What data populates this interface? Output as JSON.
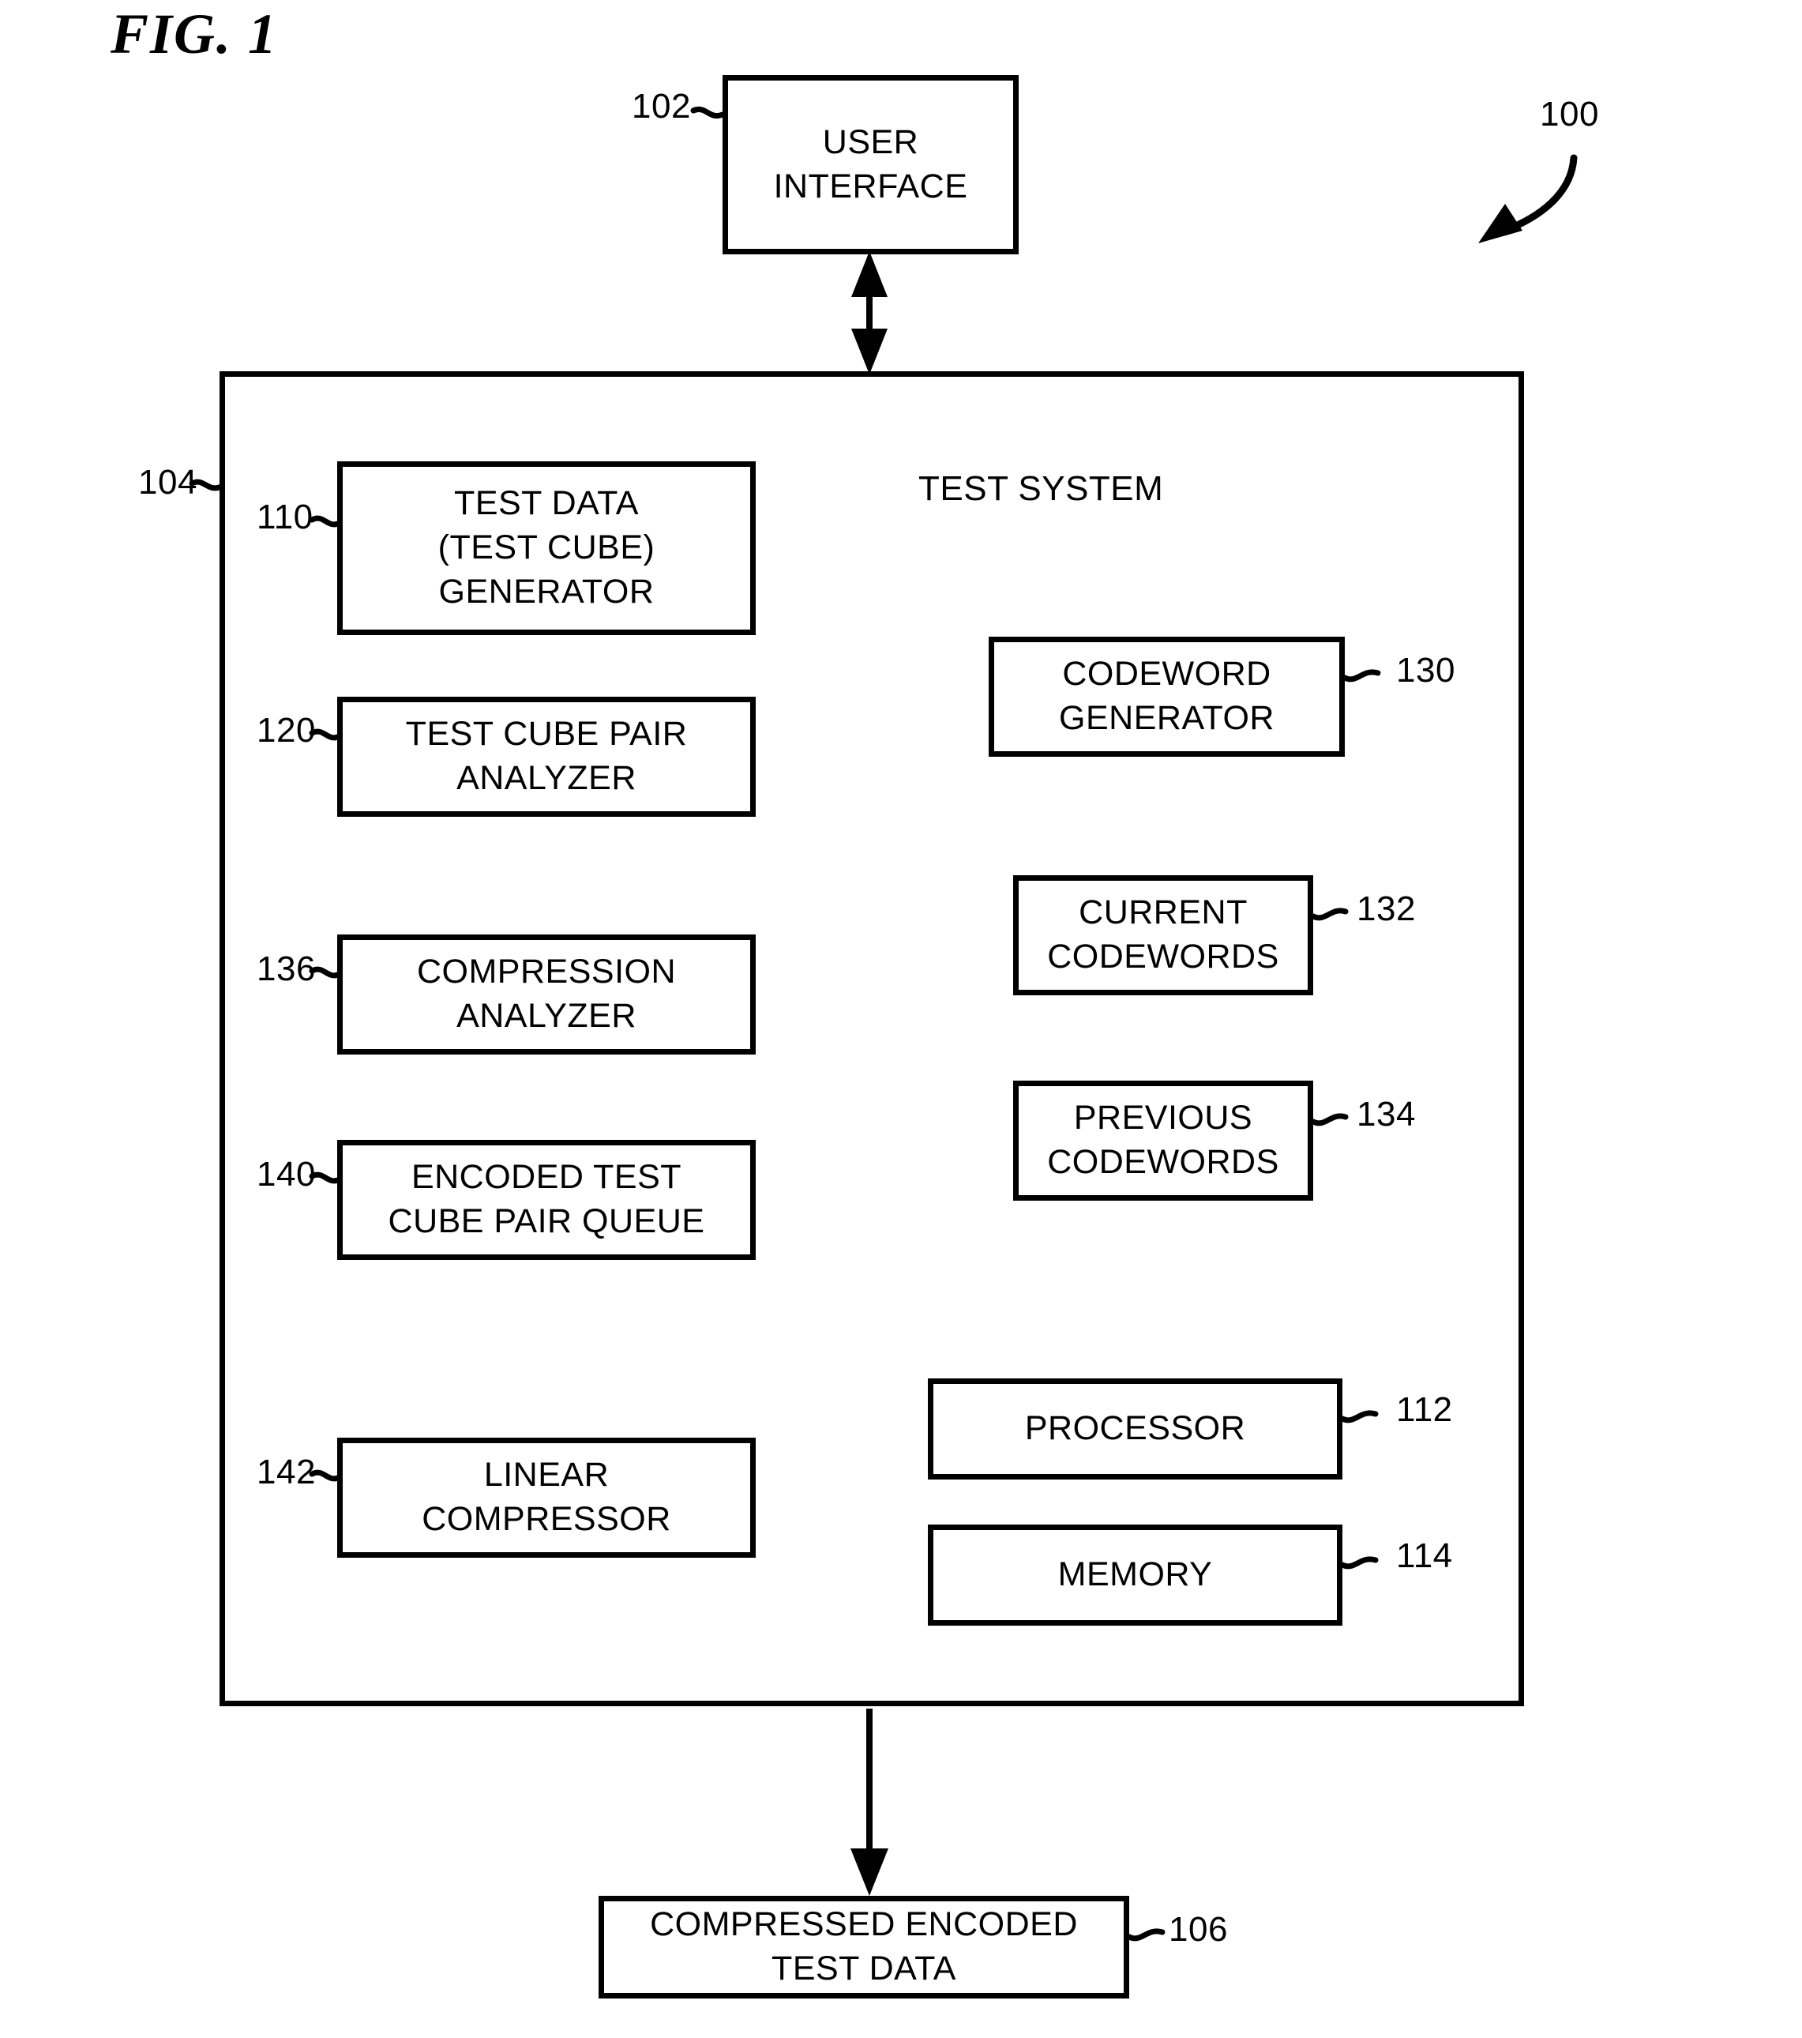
{
  "figure": {
    "title": "FIG. 1",
    "system_ref": "100"
  },
  "user_interface": {
    "label": "USER\nINTERFACE",
    "ref": "102"
  },
  "test_system": {
    "title": "TEST SYSTEM",
    "ref": "104",
    "left_modules": [
      {
        "label": "TEST DATA\n(TEST CUBE)\nGENERATOR",
        "ref": "110"
      },
      {
        "label": "TEST CUBE PAIR\nANALYZER",
        "ref": "120"
      },
      {
        "label": "COMPRESSION\nANALYZER",
        "ref": "136"
      },
      {
        "label": "ENCODED TEST\nCUBE PAIR QUEUE",
        "ref": "140"
      },
      {
        "label": "LINEAR\nCOMPRESSOR",
        "ref": "142"
      }
    ],
    "right_modules": [
      {
        "label": "CODEWORD\nGENERATOR",
        "ref": "130"
      },
      {
        "label": "CURRENT\nCODEWORDS",
        "ref": "132"
      },
      {
        "label": "PREVIOUS\nCODEWORDS",
        "ref": "134"
      },
      {
        "label": "PROCESSOR",
        "ref": "112"
      },
      {
        "label": "MEMORY",
        "ref": "114"
      }
    ]
  },
  "output": {
    "label": "COMPRESSED ENCODED\nTEST DATA",
    "ref": "106"
  },
  "colors": {
    "ink": "#000000",
    "paper": "#ffffff"
  }
}
